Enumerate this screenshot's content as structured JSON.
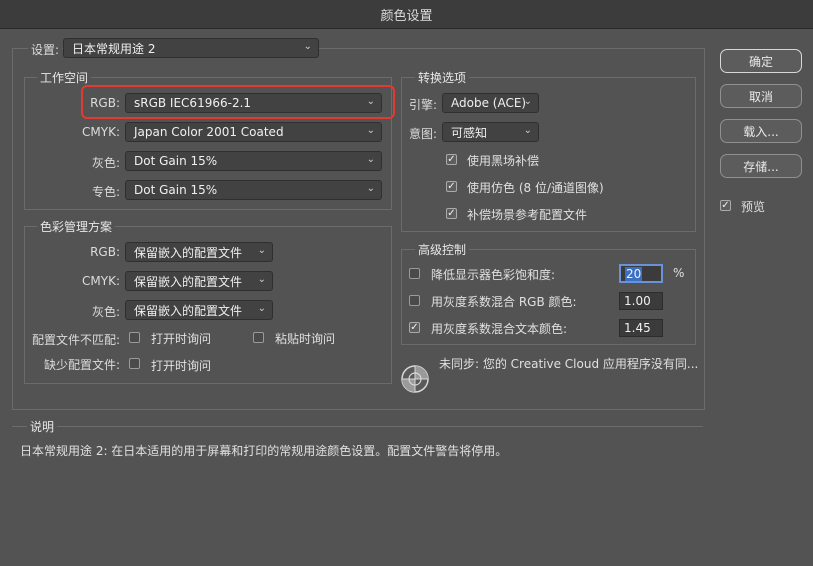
{
  "window": {
    "title": "颜色设置"
  },
  "settings": {
    "label": "设置:",
    "value": "日本常规用途 2"
  },
  "working_spaces": {
    "title": "工作空间",
    "rgb": {
      "label": "RGB:",
      "value": "sRGB IEC61966-2.1"
    },
    "cmyk": {
      "label": "CMYK:",
      "value": "Japan Color 2001 Coated"
    },
    "gray": {
      "label": "灰色:",
      "value": "Dot Gain 15%"
    },
    "spot": {
      "label": "专色:",
      "value": "Dot Gain 15%"
    }
  },
  "color_management": {
    "title": "色彩管理方案",
    "rgb": {
      "label": "RGB:",
      "value": "保留嵌入的配置文件"
    },
    "cmyk": {
      "label": "CMYK:",
      "value": "保留嵌入的配置文件"
    },
    "gray": {
      "label": "灰色:",
      "value": "保留嵌入的配置文件"
    },
    "mismatch": {
      "label": "配置文件不匹配:",
      "ask_open": "打开时询问",
      "ask_paste": "粘贴时询问"
    },
    "missing": {
      "label": "缺少配置文件:",
      "ask_open": "打开时询问"
    }
  },
  "conversion": {
    "title": "转换选项",
    "engine": {
      "label": "引擎:",
      "value": "Adobe (ACE)"
    },
    "intent": {
      "label": "意图:",
      "value": "可感知"
    },
    "black_point": "使用黑场补偿",
    "dither": "使用仿色 (8 位/通道图像)",
    "compensate": "补偿场景参考配置文件"
  },
  "advanced": {
    "title": "高级控制",
    "desaturate": {
      "label": "降低显示器色彩饱和度:",
      "value": "20",
      "unit": "%"
    },
    "blend_rgb": {
      "label": "用灰度系数混合 RGB 颜色:",
      "value": "1.00"
    },
    "blend_text": {
      "label": "用灰度系数混合文本颜色:",
      "value": "1.45"
    }
  },
  "sync": {
    "text": "未同步: 您的 Creative Cloud 应用程序没有同..."
  },
  "description": {
    "title": "说明",
    "text": "日本常规用途 2:  在日本适用的用于屏幕和打印的常规用途颜色设置。配置文件警告将停用。"
  },
  "buttons": {
    "ok": "确定",
    "cancel": "取消",
    "load": "载入...",
    "save": "存储..."
  },
  "preview": {
    "label": "预览"
  },
  "colors": {
    "highlight": "#e23a31",
    "focus": "#3b6fc4"
  }
}
